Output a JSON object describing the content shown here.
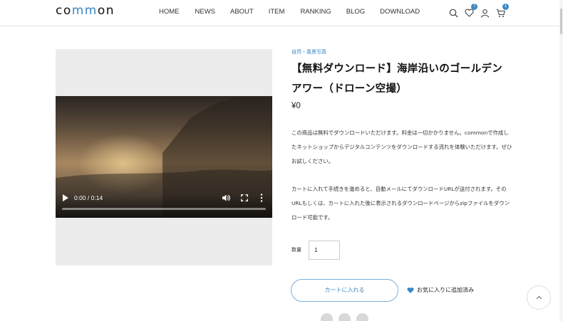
{
  "header": {
    "logo": {
      "pre": "co",
      "accent": "mm",
      "post": "on"
    },
    "nav": [
      "HOME",
      "NEWS",
      "ABOUT",
      "ITEM",
      "RANKING",
      "BLOG",
      "DOWNLOAD"
    ],
    "icons": {
      "search": "search-icon",
      "wishlist": "heart-icon",
      "account": "user-icon",
      "cart": "cart-icon"
    },
    "wishlist_count": "7",
    "cart_count": "1"
  },
  "video": {
    "time": "0:00 / 0:14",
    "progress": 0.0
  },
  "product": {
    "category": "自然・風景写真",
    "title": "【無料ダウンロード】海岸沿いのゴールデンアワー（ドローン空撮）",
    "price": "¥0",
    "description_1": "この商品は無料でダウンロードいただけます。料金は一切かかりません。commonで作成したネットショップからデジタルコンテンツをダウンロードする流れを体験いただけます。ぜひお試しください。",
    "description_2": "カートに入れて手続きを進めると、自動メールにてダウンロードURLが送付されます。そのURLもしくは、カートに入れた後に表示されるダウンロードページからzipファイルをダウンロード可能です。",
    "quantity_label": "数量",
    "quantity_value": "1",
    "cart_button": "カートに入れる",
    "favorite_label": "お気に入りに追加済み"
  },
  "colors": {
    "accent": "#3b88c4"
  }
}
